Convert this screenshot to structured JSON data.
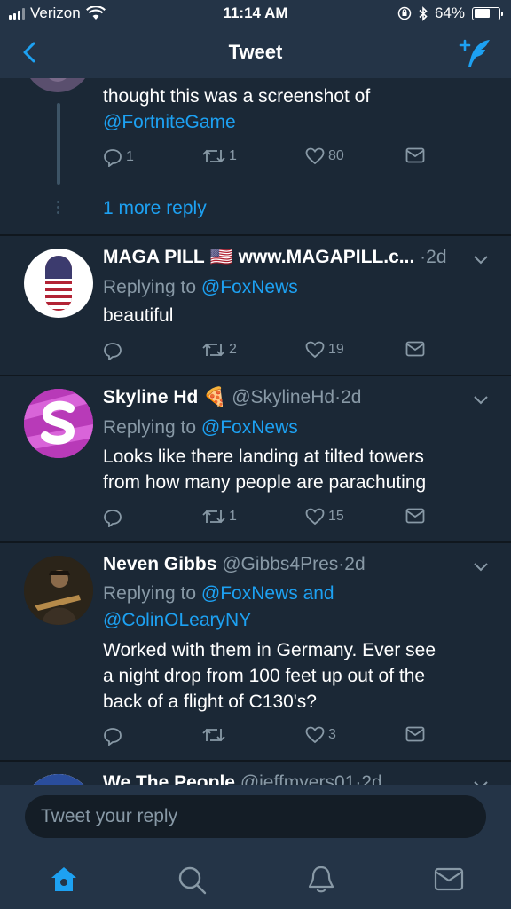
{
  "status_bar": {
    "carrier": "Verizon",
    "time": "11:14 AM",
    "battery_percent": "64%",
    "battery_level": 0.64
  },
  "nav": {
    "title": "Tweet"
  },
  "parent_tweet": {
    "text_line1": "thought this was a screenshot of",
    "mention": "@FortniteGame",
    "replies": "1",
    "retweets": "1",
    "likes": "80",
    "more_replies": "1 more reply"
  },
  "tweets": [
    {
      "name": "MAGA PILL",
      "flag": "🇺🇸",
      "handle": "www.MAGAPILL.c...",
      "time": "2d",
      "replying_label": "Replying to",
      "replying_to": "@FoxNews",
      "text": "beautiful",
      "replies": "",
      "retweets": "2",
      "likes": "19"
    },
    {
      "name": "Skyline Hd",
      "emoji": "🍕",
      "handle": "@SkylineHd",
      "time": "2d",
      "replying_label": "Replying to",
      "replying_to": "@FoxNews",
      "text_line1": "Looks like there landing at tilted towers",
      "text_line2": "from how many people are parachuting",
      "replies": "",
      "retweets": "1",
      "likes": "15"
    },
    {
      "name": "Neven Gibbs",
      "handle": "@Gibbs4Pres",
      "time": "2d",
      "replying_label": "Replying to",
      "replying_to": "@FoxNews and",
      "replying_to2": "@ColinOLearyNY",
      "text_line1": "Worked with them in Germany. Ever see",
      "text_line2": "a night drop from 100 feet up out of the",
      "text_line3": "back of a flight of C130's?",
      "replies": "",
      "retweets": "",
      "likes": "3"
    },
    {
      "name": "We The People",
      "handle": "@jeffmyers01",
      "time": "2d"
    }
  ],
  "reply_bar": {
    "placeholder": "Tweet your reply"
  },
  "colors": {
    "background": "#1b2836",
    "bar": "#243447",
    "accent": "#1da1f2",
    "muted": "#8899a6"
  },
  "tab_icons": [
    "home-icon",
    "search-icon",
    "notifications-icon",
    "messages-icon"
  ]
}
